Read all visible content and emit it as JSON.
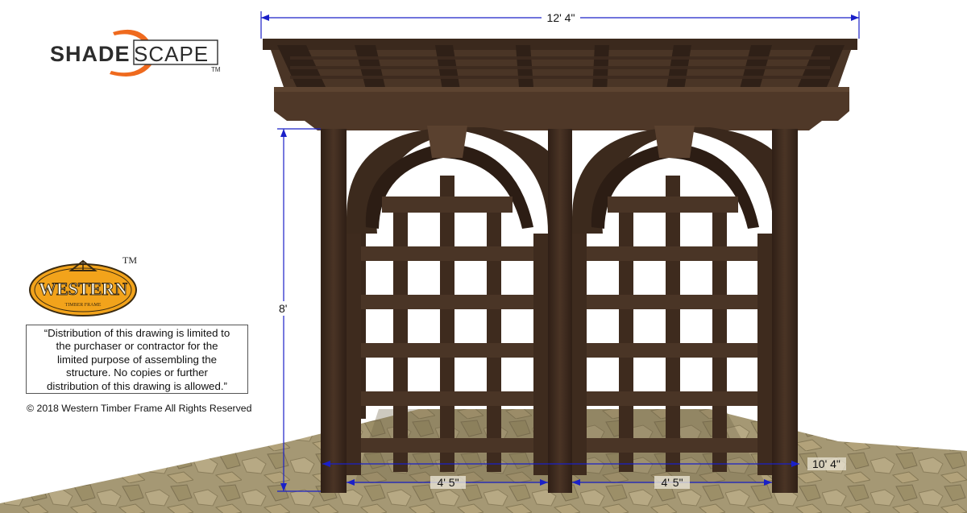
{
  "brand": {
    "shade_part": "SHADE",
    "scape_part": "SCAPE",
    "trademark": "TM",
    "accent_color": "#ef6a1e"
  },
  "western_logo": {
    "word": "WESTERN",
    "subtitle": "TIMBER FRAME",
    "trademark": "TM",
    "fill_color": "#f2a31b"
  },
  "notice": {
    "lines": [
      "“Distribution of this drawing is limited to",
      "the purchaser or contractor for the",
      "limited purpose of assembling the",
      "structure.  No copies or further",
      "distribution of this drawing is allowed.”"
    ]
  },
  "copyright": "© 2018 Western Timber Frame All Rights Reserved",
  "dimensions": {
    "overall_width": "12' 4\"",
    "height": "8'",
    "depth": "10' 4\"",
    "bay_left": "4' 5\"",
    "bay_right": "4' 5\""
  },
  "colors": {
    "wood": "#3e2a1e",
    "wood_light": "#56402f",
    "dimension_line": "#1a20c8",
    "ground": "#9a8d69"
  }
}
